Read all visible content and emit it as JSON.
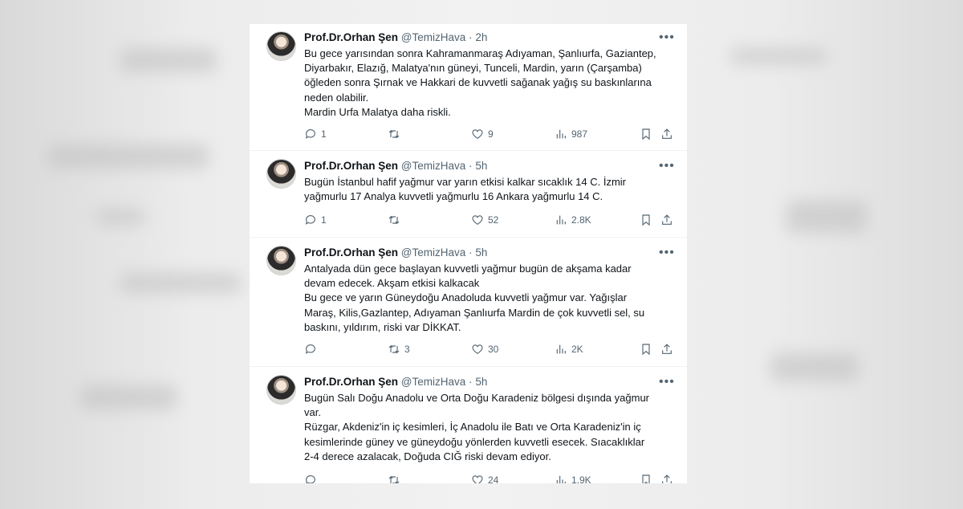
{
  "tweets": [
    {
      "name": "Prof.Dr.Orhan Şen",
      "handle": "@TemizHava",
      "sep": "·",
      "time": "2h",
      "lines": [
        "Bu gece yarısından sonra Kahramanmaraş Adıyaman, Şanlıurfa, Gaziantep,",
        "Diyarbakır, Elazığ, Malatya'nın güneyi,  Tunceli, Mardin, yarın  (Çarşamba)",
        "öğleden sonra Şırnak ve Hakkari de kuvvetli sağanak yağış su baskınlarına",
        "neden olabilir.",
        "Mardin Urfa Malatya daha riskli."
      ],
      "replies": "1",
      "retweets": "",
      "likes": "9",
      "views": "987"
    },
    {
      "name": "Prof.Dr.Orhan Şen",
      "handle": "@TemizHava",
      "sep": "·",
      "time": "5h",
      "lines": [
        "Bugün İstanbul hafif yağmur var yarın etkisi kalkar sıcaklık 14 C. İzmir",
        "yağmurlu 17 Analya kuvvetli yağmurlu 16 Ankara yağmurlu 14 C."
      ],
      "replies": "1",
      "retweets": "",
      "likes": "52",
      "views": "2.8K"
    },
    {
      "name": "Prof.Dr.Orhan Şen",
      "handle": "@TemizHava",
      "sep": "·",
      "time": "5h",
      "lines": [
        "Antalyada dün gece başlayan kuvvetli yağmur bugün de akşama kadar",
        "devam edecek. Akşam etkisi kalkacak",
        "Bu gece ve yarın Güneydoğu Anadoluda kuvvetli yağmur var. Yağışlar",
        "Maraş, Kilis,Gazlantep, Adıyaman Şanlıurfa Mardin de çok kuvvetli sel, su",
        "baskını, yıldırım, riski var DİKKAT."
      ],
      "replies": "",
      "retweets": "3",
      "likes": "30",
      "views": "2K"
    },
    {
      "name": "Prof.Dr.Orhan Şen",
      "handle": "@TemizHava",
      "sep": "·",
      "time": "5h",
      "lines": [
        "Bugün Salı Doğu Anadolu ve Orta Doğu Karadeniz bölgesi dışında yağmur",
        "var.",
        "Rüzgar, Akdeniz'in iç kesimleri, İç Anadolu ile Batı ve Orta Karadeniz'in iç",
        "kesimlerinde güney ve güneydoğu yönlerden kuvvetli esecek. Sıacaklıklar",
        "2-4 derece azalacak, Doğuda CIĞ riski devam ediyor."
      ],
      "replies": "",
      "retweets": "",
      "likes": "24",
      "views": "1.9K"
    }
  ],
  "icons": {
    "more": "more-horizontal-icon",
    "reply": "reply-icon",
    "retweet": "retweet-icon",
    "like": "heart-icon",
    "views": "views-chart-icon",
    "bookmark": "bookmark-icon",
    "share": "share-icon"
  },
  "colors": {
    "text": "#0f1419",
    "secondary": "#536471",
    "card": "#ffffff",
    "backdrop": "#e4e4e4"
  }
}
